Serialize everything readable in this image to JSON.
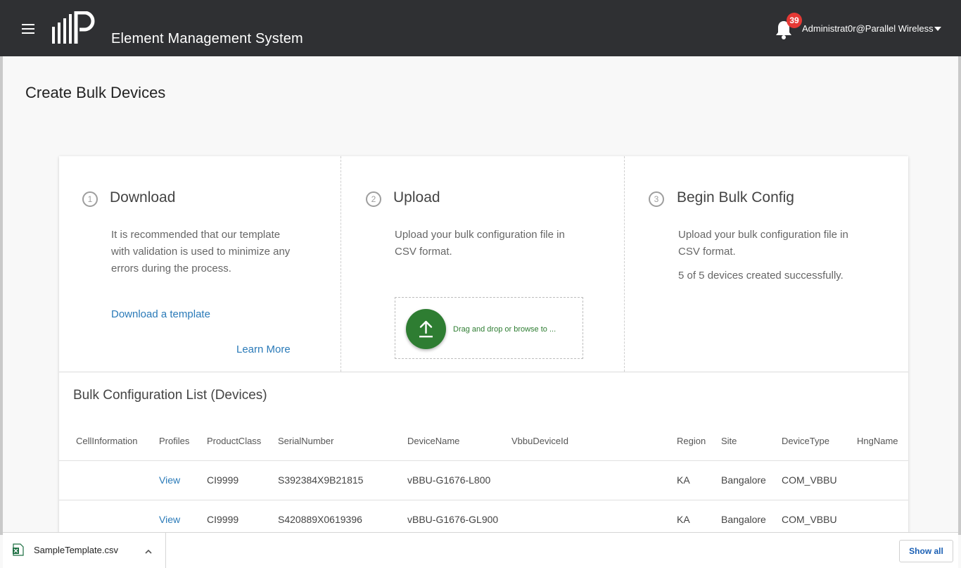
{
  "header": {
    "app_title": "Element Management System",
    "notification_count": "39",
    "user": "Administrat0r@Parallel Wireless"
  },
  "page": {
    "title": "Create Bulk Devices"
  },
  "steps": [
    {
      "number": "1",
      "title": "Download",
      "text": "It is recommended that our template with validation is used to minimize any errors during the process.",
      "link": "Download a template",
      "learn_more": "Learn More"
    },
    {
      "number": "2",
      "title": "Upload",
      "text": "Upload your bulk configuration file in CSV format.",
      "dropzone_text": "Drag and drop or browse to ..."
    },
    {
      "number": "3",
      "title": "Begin Bulk Config",
      "text": "Upload your bulk configuration file in CSV format.",
      "status": "5 of 5 devices created successfully."
    }
  ],
  "table": {
    "title": "Bulk Configuration List (Devices)",
    "columns": [
      "CellInformation",
      "Profiles",
      "ProductClass",
      "SerialNumber",
      "DeviceName",
      "VbbuDeviceId",
      "Region",
      "Site",
      "DeviceType",
      "HngName"
    ],
    "rows": [
      {
        "cell": "",
        "profiles": "View",
        "product_class": "CI9999",
        "serial": "S392384X9B21815",
        "device_name": "vBBU-G1676-L800",
        "vbbu_id": "",
        "region": "KA",
        "site": "Bangalore",
        "device_type": "COM_VBBU",
        "hng": ""
      },
      {
        "cell": "",
        "profiles": "View",
        "product_class": "CI9999",
        "serial": "S420889X0619396",
        "device_name": "vBBU-G1676-GL900",
        "vbbu_id": "",
        "region": "KA",
        "site": "Bangalore",
        "device_type": "COM_VBBU",
        "hng": ""
      }
    ]
  },
  "downloads": {
    "file_name": "SampleTemplate.csv",
    "show_all": "Show all"
  },
  "colors": {
    "header_bg": "#2f3033",
    "badge": "#e53935",
    "upload_green": "#2e7d32",
    "link_blue": "#2a7ab8"
  }
}
